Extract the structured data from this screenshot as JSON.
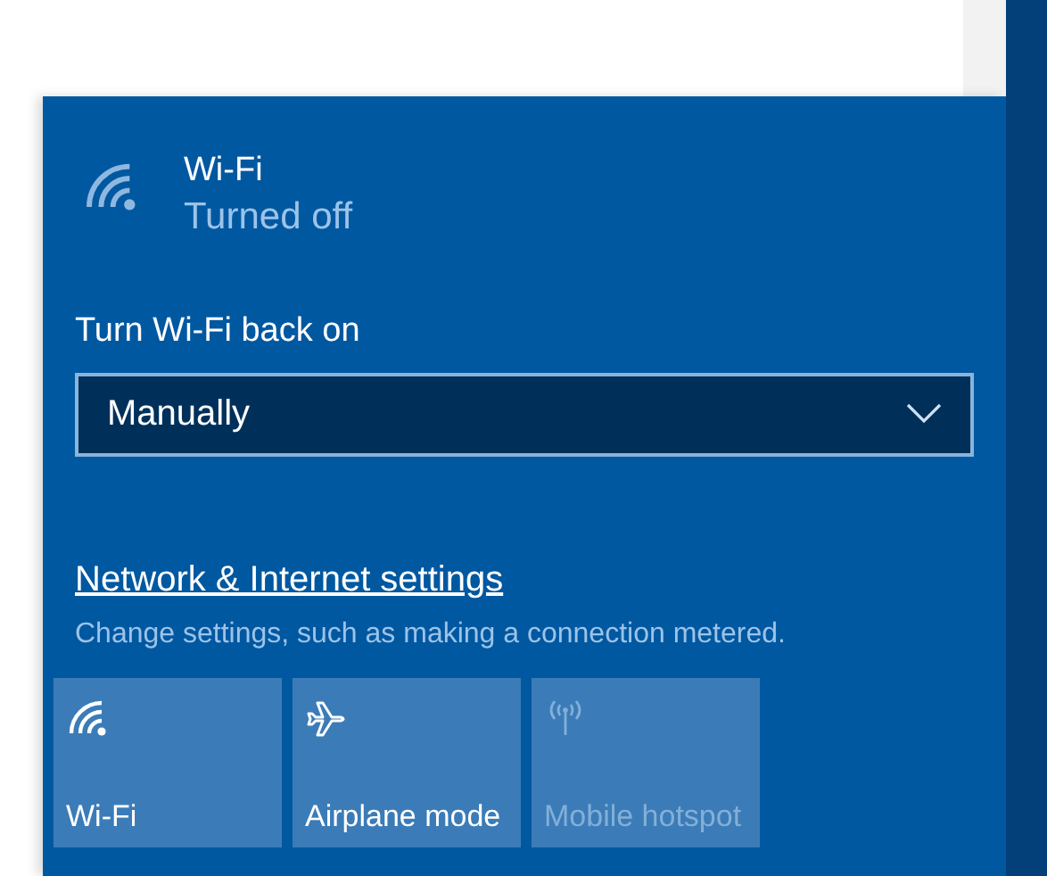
{
  "network": {
    "name": "Wi-Fi",
    "status": "Turned off"
  },
  "turn_back_on": {
    "label": "Turn Wi-Fi back on",
    "dropdown": {
      "value": "Manually"
    }
  },
  "settings_link": {
    "label": "Network & Internet settings",
    "description": "Change settings, such as making a connection metered."
  },
  "quick_actions": [
    {
      "kind": "wifi",
      "label": "Wi-Fi",
      "disabled": false
    },
    {
      "kind": "airplane",
      "label": "Airplane mode",
      "disabled": false
    },
    {
      "kind": "hotspot",
      "label": "Mobile hotspot",
      "disabled": true
    }
  ]
}
